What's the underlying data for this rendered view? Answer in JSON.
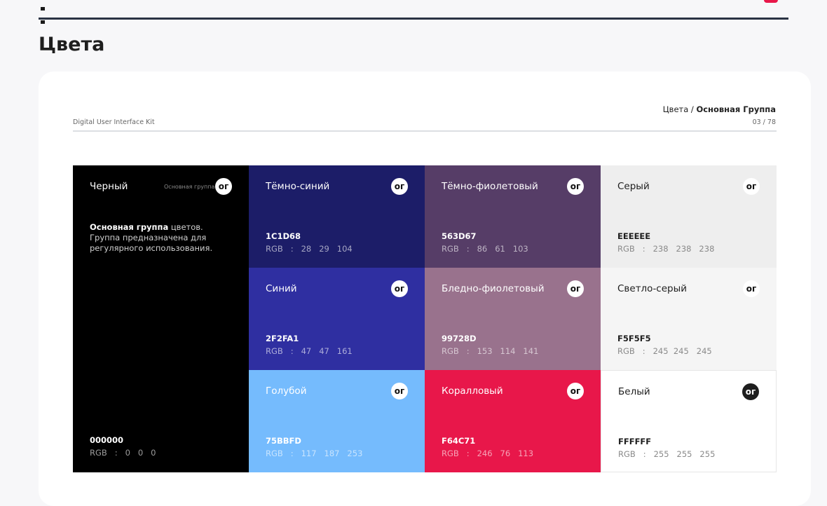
{
  "page": {
    "title": "Цвета"
  },
  "card": {
    "kit_label": "Digital User Interface Kit",
    "breadcrumb_prefix": "Цвета /",
    "breadcrumb_current": "Основная Группа",
    "page_number": "03 / 78"
  },
  "badge_label": "ог",
  "black": {
    "name": "Черный",
    "group": "Основная группа",
    "desc_bold": "Основная группа",
    "desc_rest": " цветов. Группа предназначена для регулярного использования.",
    "hex": "000000",
    "rgb": "RGB   :   0   0   0",
    "color": "#000000"
  },
  "swatches": [
    {
      "name": "Тёмно-синий",
      "hex": "1C1D68",
      "rgb": "RGB   :   28   29   104",
      "color": "#1C1D68",
      "tone": "dark"
    },
    {
      "name": "Тёмно-фиолетовый",
      "hex": "563D67",
      "rgb": "RGB   :   86   61   103",
      "color": "#563D67",
      "tone": "dark"
    },
    {
      "name": "Серый",
      "hex": "EEEEEE",
      "rgb": "RGB   :   238   238   238",
      "color": "#EEEEEE",
      "tone": "light"
    },
    {
      "name": "Синий",
      "hex": "2F2FA1",
      "rgb": "RGB   :   47   47   161",
      "color": "#2F2FA1",
      "tone": "dark"
    },
    {
      "name": "Бледно-фиолетовый",
      "hex": "99728D",
      "rgb": "RGB   :   153   114   141",
      "color": "#99728D",
      "tone": "dark"
    },
    {
      "name": "Светло-серый",
      "hex": "F5F5F5",
      "rgb": "RGB   :   245  245   245",
      "color": "#F5F5F5",
      "tone": "light"
    },
    {
      "name": "Голубой",
      "hex": "75BBFD",
      "rgb": "RGB   :   117   187   253",
      "color": "#75BBFD",
      "tone": "dark"
    },
    {
      "name": "Коралловый",
      "hex": "F64C71",
      "rgb": "RGB   :   246   76   113",
      "color": "#E8174A",
      "tone": "dark"
    },
    {
      "name": "Белый",
      "hex": "FFFFFF",
      "rgb": "RGB   :   255   255   255",
      "color": "#FFFFFF",
      "tone": "light",
      "badge": "dark"
    }
  ]
}
